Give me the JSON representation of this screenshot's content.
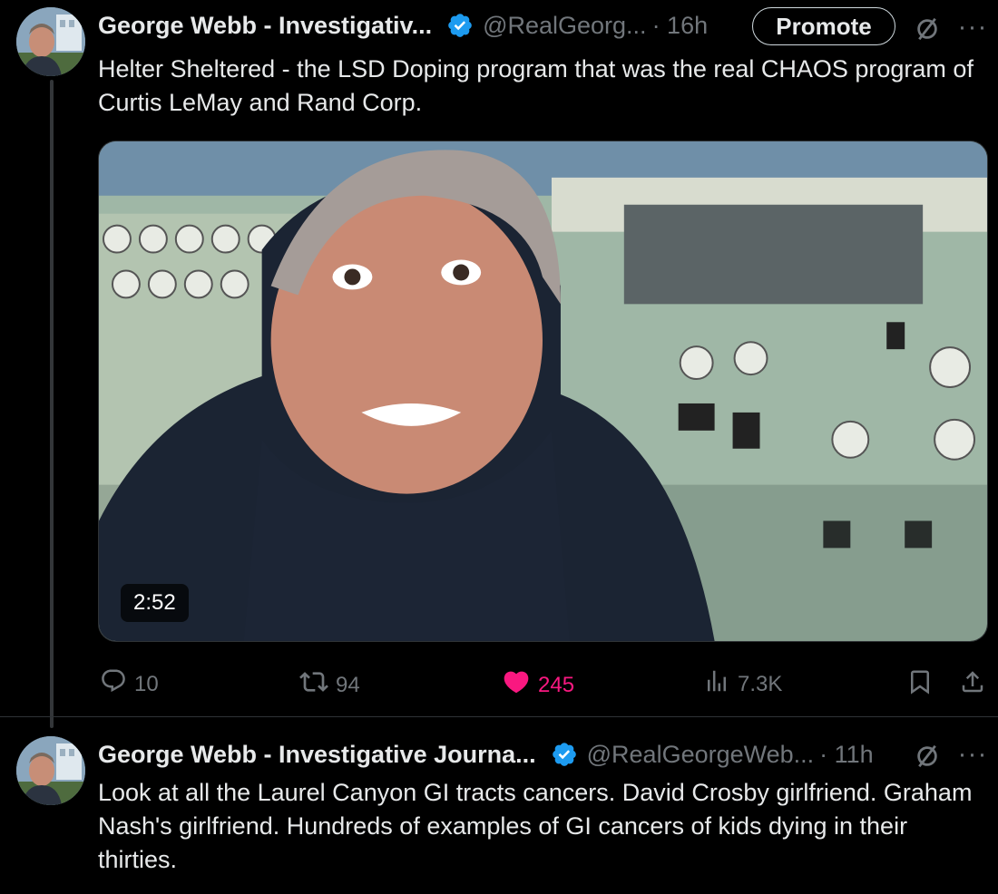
{
  "colors": {
    "accent": "#1d9bf0",
    "like": "#f91880",
    "muted": "#71767b",
    "text": "#e7e9ea"
  },
  "tweet1": {
    "author_name": "George Webb - Investigativ...",
    "handle": "@RealGeorg...",
    "time": "· 16h",
    "promote_label": "Promote",
    "text": "Helter Sheltered - the LSD Doping program that was the real CHAOS program of Curtis LeMay and Rand Corp.",
    "video_duration": "2:52",
    "replies": "10",
    "reposts": "94",
    "likes": "245",
    "views": "7.3K"
  },
  "tweet2": {
    "author_name": "George Webb - Investigative Journa...",
    "handle": "@RealGeorgeWeb...",
    "time": "· 11h",
    "text": "Look at all the Laurel Canyon GI tracts cancers. David Crosby girlfriend. Graham Nash's girlfriend. Hundreds of examples of GI cancers of kids dying in their thirties."
  },
  "icons": [
    "verified-badge-icon",
    "grok-icon",
    "more-icon",
    "reply-icon",
    "repost-icon",
    "like-icon",
    "views-icon",
    "bookmark-icon",
    "share-icon"
  ]
}
